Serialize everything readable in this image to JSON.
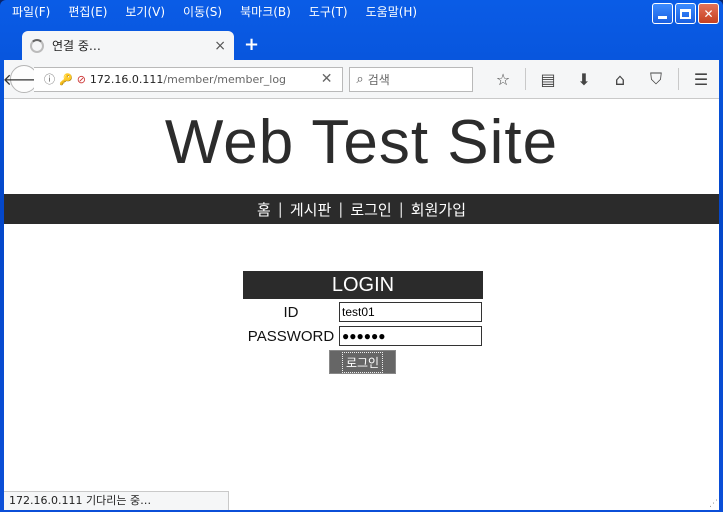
{
  "menubar": {
    "items": [
      "파일(F)",
      "편집(E)",
      "보기(V)",
      "이동(S)",
      "북마크(B)",
      "도구(T)",
      "도움말(H)"
    ]
  },
  "tab": {
    "title": "연결 중…",
    "close": "×",
    "new_tab": "+"
  },
  "toolbar": {
    "url_host": "172.16.0.111",
    "url_path": "/member/member_log",
    "url_clear": "✕",
    "search_placeholder": "검색"
  },
  "site": {
    "title": "Web Test Site",
    "nav": [
      "홈",
      "게시판",
      "로그인",
      "회원가입"
    ],
    "nav_separator": "|"
  },
  "login": {
    "header": "LOGIN",
    "id_label": "ID",
    "id_value": "test01",
    "password_label": "PASSWORD",
    "password_value": "●●●●●●",
    "submit_label": "로그인"
  },
  "status": {
    "text": "172.16.0.111 기다리는 중…"
  },
  "colors": {
    "titlebar": "#0a5ce6",
    "nav_bg": "#2b2b2b",
    "login_button": "#666666"
  }
}
